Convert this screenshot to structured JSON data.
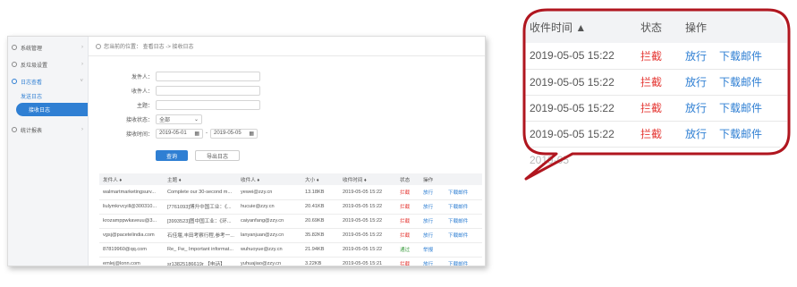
{
  "sidebar": {
    "items": [
      {
        "label": "系统管理",
        "arrow": "›"
      },
      {
        "label": "反垃圾设置",
        "arrow": "›"
      },
      {
        "label": "日志查看",
        "arrow": "˅"
      }
    ],
    "subitems": [
      {
        "label": "发送日志"
      },
      {
        "label": "接收日志"
      }
    ],
    "stats": {
      "label": "统计报表",
      "arrow": "›"
    }
  },
  "breadcrumb": {
    "text": "您当前的位置：  查看日志  ->   接收日志"
  },
  "form": {
    "sender_label": "发件人：",
    "recipient_label": "收件人：",
    "subject_label": "主题：",
    "status_label": "接收状态：",
    "status_value": "全部",
    "time_label": "接收时间：",
    "date_from": "2019-05-01",
    "date_to": "2019-05-05",
    "dash": "-",
    "query_button": "查询",
    "export_button": "导出日志"
  },
  "table": {
    "headers": [
      "发件人 ♦",
      "主题 ♦",
      "收件人 ♦",
      "大小 ♦",
      "收件时间 ♦",
      "状态",
      "操作",
      ""
    ],
    "rows": [
      {
        "sender": "walmartmarketingsurv...",
        "subject": "Complete our 30-second m...",
        "recipient": "yewei@zzy.cn",
        "size": "13.18KB",
        "time": "2019-05-05 15:22",
        "status": "拦截",
        "action1": "放行",
        "action2": "下载邮件"
      },
      {
        "sender": "liulymkrvcyill@300310...",
        "subject": "[7761093]博升中国工业：《...",
        "recipient": "hucuie@zzy.cn",
        "size": "20.41KB",
        "time": "2019-05-05 15:22",
        "status": "拦截",
        "action1": "放行",
        "action2": "下载邮件"
      },
      {
        "sender": "krozamppwkaveuu@3...",
        "subject": "[3993523]图中国工业：《环...",
        "recipient": "caiyanfang@zzy.cn",
        "size": "20.69KB",
        "time": "2019-05-05 15:22",
        "status": "拦截",
        "action1": "放行",
        "action2": "下载邮件"
      },
      {
        "sender": "vgsj@pacetelindia.com",
        "subject": "石佳堰,丰田考察行程,参考一...",
        "recipient": "lanyanjuan@zzy.cn",
        "size": "35.82KB",
        "time": "2019-05-05 15:22",
        "status": "拦截",
        "action1": "放行",
        "action2": "下载邮件"
      },
      {
        "sender": "87819960@qq.com",
        "subject": "Re_ Fw_ Important informat...",
        "recipient": "wuhuoyue@zzy.cn",
        "size": "21.94KB",
        "time": "2019-05-05 15:22",
        "status": "通过",
        "action1": "举报",
        "action2": ""
      },
      {
        "sender": "emlej@lonn.com",
        "subject": "sr13825186619r 【电话】",
        "recipient": "yuhuajiao@zzy.cn",
        "size": "3.22KB",
        "time": "2019-05-05 15:21",
        "status": "拦截",
        "action1": "放行",
        "action2": "下载邮件"
      }
    ]
  },
  "zoom": {
    "headers": [
      "收件时间 ▲",
      "状态",
      "操作",
      ""
    ],
    "rows": [
      {
        "time": "2019-05-05 15:22",
        "status": "拦截",
        "action1": "放行",
        "action2": "下载邮件"
      },
      {
        "time": "2019-05-05 15:22",
        "status": "拦截",
        "action1": "放行",
        "action2": "下载邮件"
      },
      {
        "time": "2019-05-05 15:22",
        "status": "拦截",
        "action1": "放行",
        "action2": "下载邮件"
      },
      {
        "time": "2019-05-05 15:22",
        "status": "拦截",
        "action1": "放行",
        "action2": "下载邮件"
      }
    ],
    "tail": "2019-05"
  },
  "colors": {
    "accent": "#2f7fd3",
    "blocked": "#e53935",
    "passed": "#43a047",
    "bubble": "#b0161f"
  }
}
